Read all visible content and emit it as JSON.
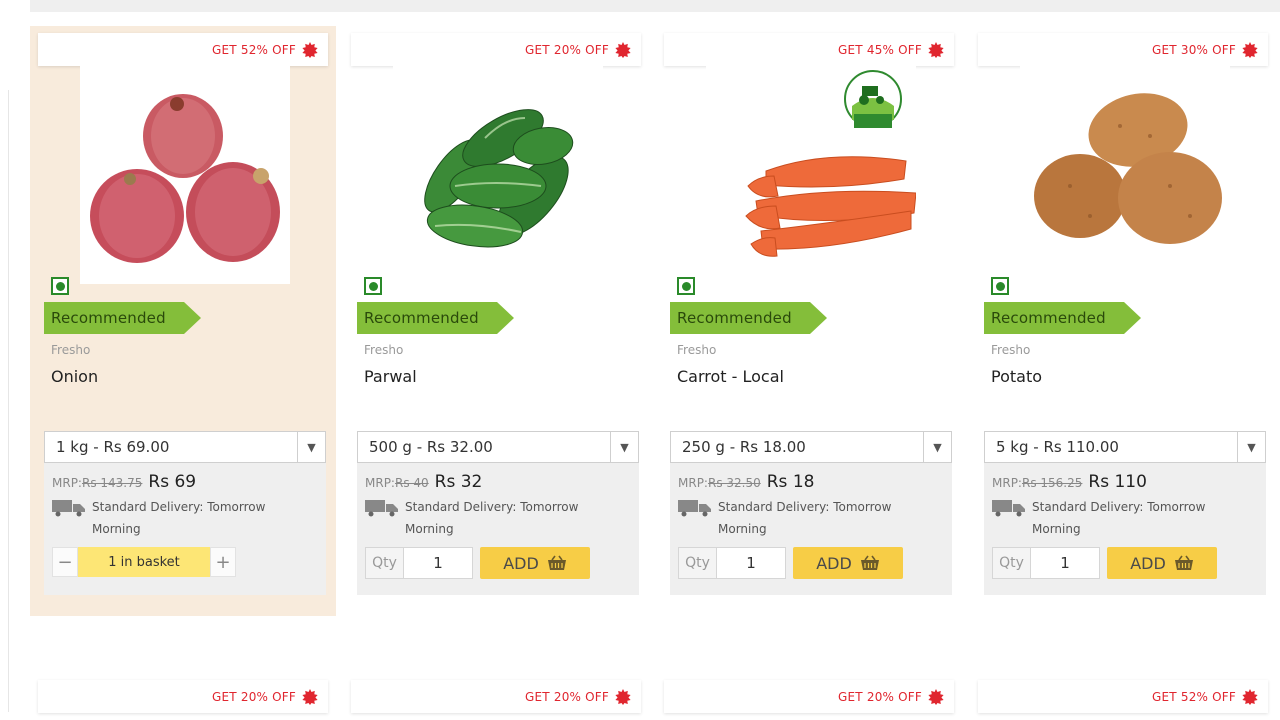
{
  "products": [
    {
      "offer": "GET 52% OFF",
      "brand": "Fresho",
      "name": "Onion",
      "recommended": "Recommended",
      "size": "1 kg - Rs 69.00",
      "mrp_label": "MRP:",
      "mrp": "Rs 143.75",
      "price": "Rs 69",
      "delivery": "Standard Delivery: Tomorrow Morning",
      "in_basket": "1 in basket",
      "image": "onion",
      "active": true
    },
    {
      "offer": "GET 20% OFF",
      "brand": "Fresho",
      "name": "Parwal",
      "recommended": "Recommended",
      "size": "500 g - Rs 32.00",
      "mrp_label": "MRP:",
      "mrp": "Rs 40",
      "price": "Rs 32",
      "delivery": "Standard Delivery: Tomorrow Morning",
      "qty_label": "Qty",
      "qty": "1",
      "add_label": "ADD",
      "image": "parwal"
    },
    {
      "offer": "GET 45% OFF",
      "brand": "Fresho",
      "name": "Carrot - Local",
      "recommended": "Recommended",
      "size": "250 g - Rs 18.00",
      "mrp_label": "MRP:",
      "mrp": "Rs 32.50",
      "price": "Rs 18",
      "delivery": "Standard Delivery: Tomorrow Morning",
      "qty_label": "Qty",
      "qty": "1",
      "add_label": "ADD",
      "image": "carrot"
    },
    {
      "offer": "GET 30% OFF",
      "brand": "Fresho",
      "name": "Potato",
      "recommended": "Recommended",
      "size": "5 kg - Rs 110.00",
      "mrp_label": "MRP:",
      "mrp": "Rs 156.25",
      "price": "Rs 110",
      "delivery": "Standard Delivery: Tomorrow Morning",
      "qty_label": "Qty",
      "qty": "1",
      "add_label": "ADD",
      "image": "potato"
    }
  ],
  "next_row_offers": [
    "GET 20% OFF",
    "GET 20% OFF",
    "GET 20% OFF",
    "GET 52% OFF"
  ],
  "stepper": {
    "minus": "−",
    "plus": "+"
  },
  "colors": {
    "offer": "#e0262f",
    "recommended": "#84be3a",
    "add": "#f7cd46",
    "in_basket": "#fde675",
    "active_card": "#f8ebdc"
  }
}
